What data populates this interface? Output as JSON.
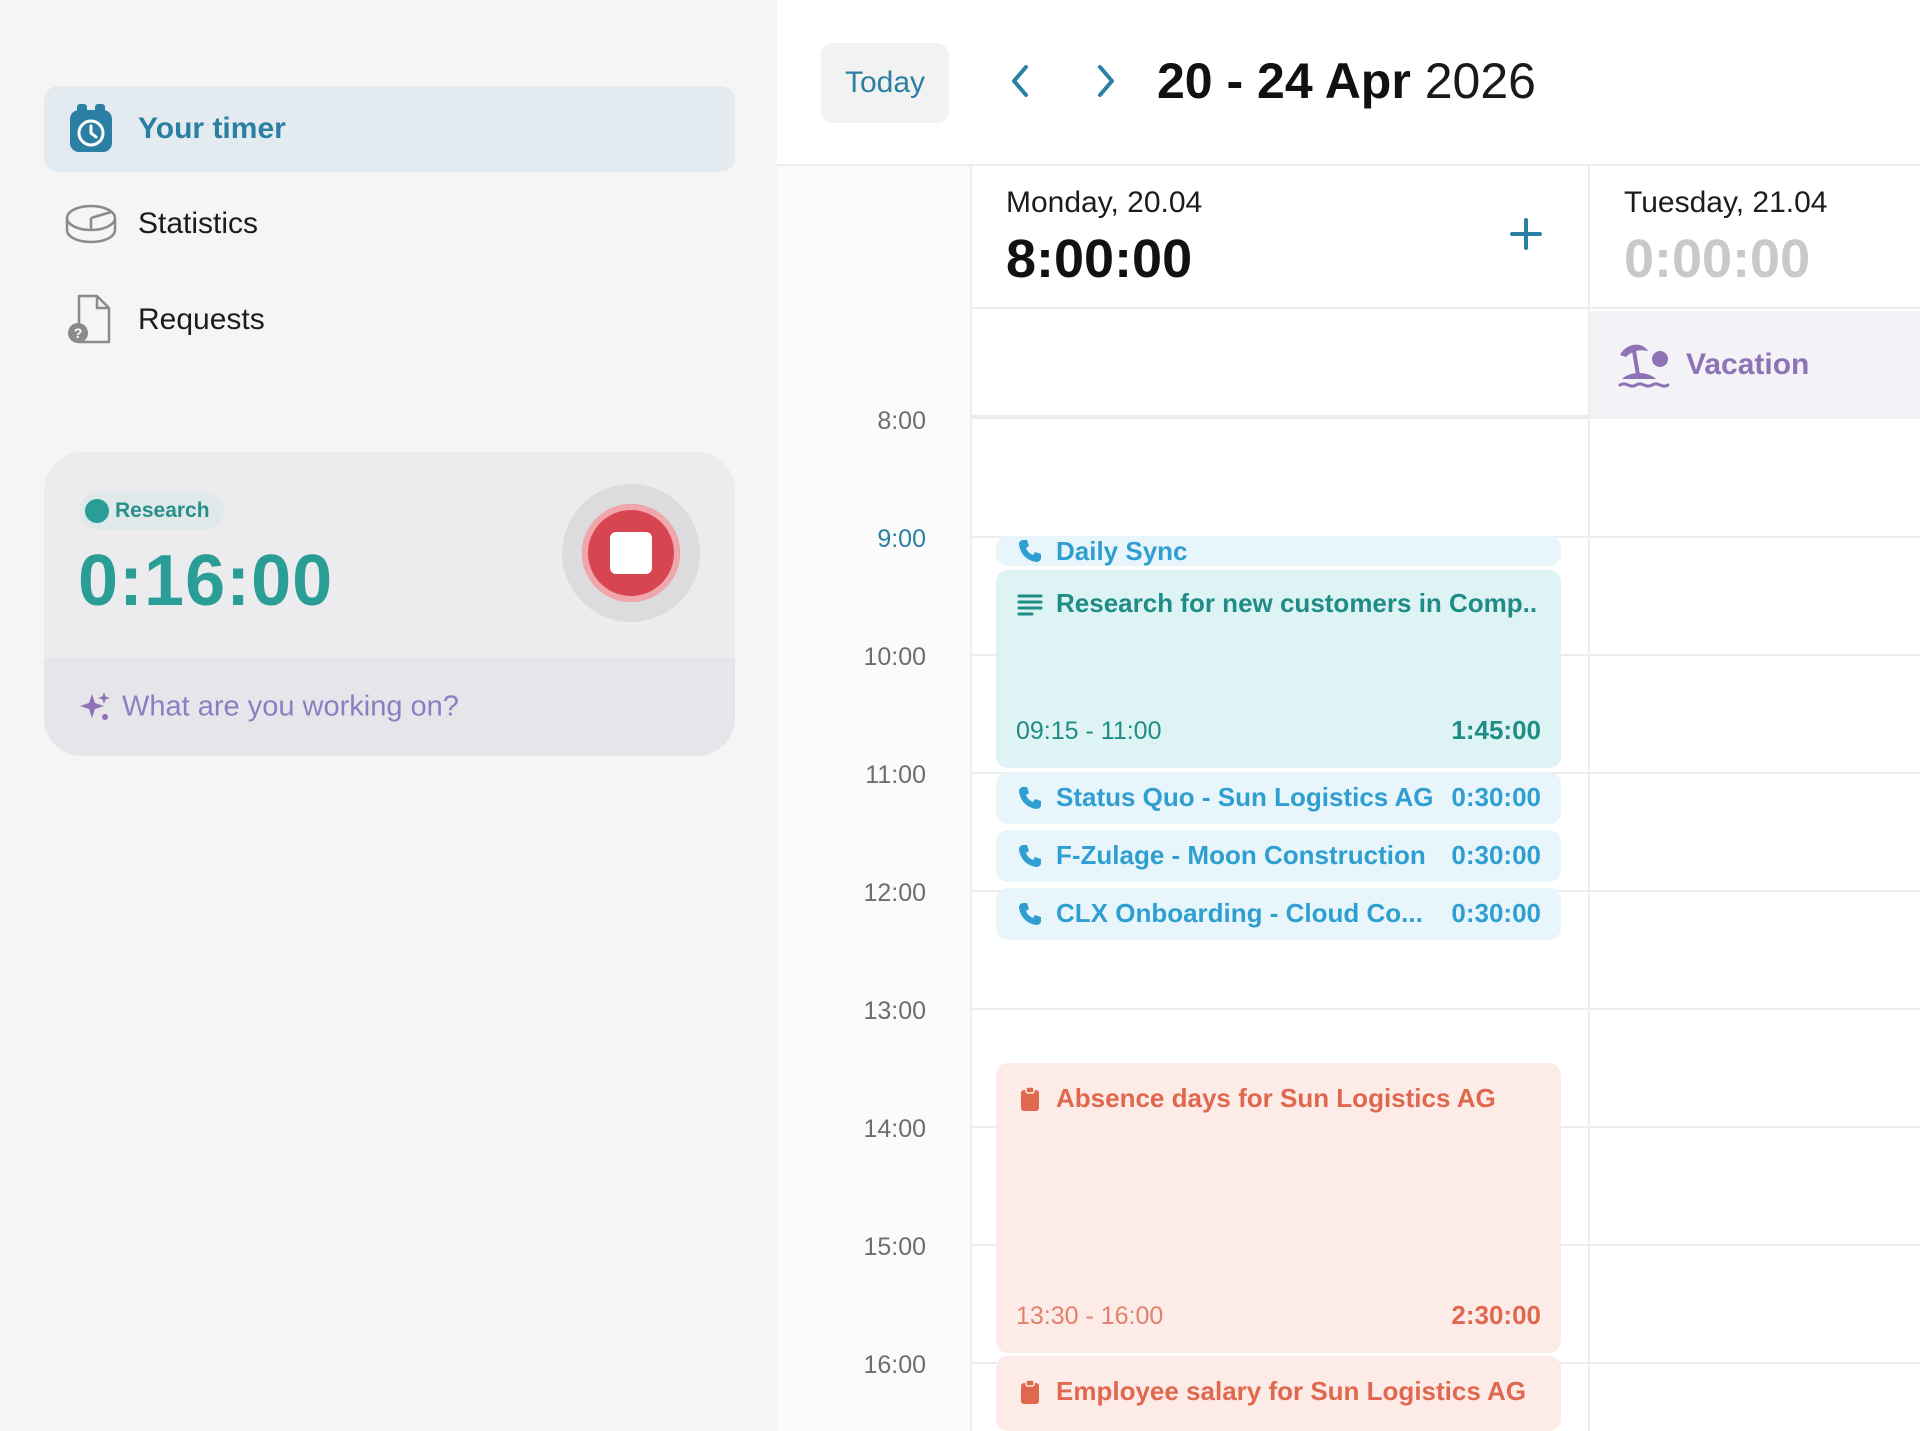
{
  "sidebar": {
    "items": [
      {
        "label": "Your timer",
        "icon": "alarm-clock-icon",
        "active": true
      },
      {
        "label": "Statistics",
        "icon": "pie-chart-icon",
        "active": false
      },
      {
        "label": "Requests",
        "icon": "document-question-icon",
        "active": false
      }
    ],
    "timer": {
      "project": "Research",
      "project_color": "#2a9d97",
      "elapsed": "0:16:00",
      "description_placeholder": "What are you working on?"
    }
  },
  "header": {
    "today_label": "Today",
    "range_bold": "20 - 24 Apr",
    "range_year": "2026"
  },
  "hours": [
    "8:00",
    "9:00",
    "10:00",
    "11:00",
    "12:00",
    "13:00",
    "14:00",
    "15:00",
    "16:00"
  ],
  "current_hour": "9:00",
  "days": [
    {
      "name": "Monday, 20.04",
      "total": "8:00:00"
    },
    {
      "name": "Tuesday, 21.04",
      "total": "0:00:00",
      "all_day": {
        "label": "Vacation",
        "icon": "island-palm-icon"
      }
    }
  ],
  "events": [
    {
      "title": "Daily Sync",
      "icon": "phone-icon",
      "color": "#2f9fd1"
    },
    {
      "title": "Research for new customers in Comp...",
      "icon": "text-lines-icon",
      "time_range": "09:15 - 11:00",
      "duration": "1:45:00",
      "color": "#1f8c86"
    },
    {
      "title": "Status Quo - Sun Logistics AG",
      "icon": "phone-icon",
      "duration": "0:30:00",
      "color": "#2f9fd1"
    },
    {
      "title": "F-Zulage - Moon Construction",
      "icon": "phone-icon",
      "duration": "0:30:00",
      "color": "#2f9fd1"
    },
    {
      "title": "CLX Onboarding - Cloud Co...",
      "icon": "phone-icon",
      "duration": "0:30:00",
      "color": "#2f9fd1"
    },
    {
      "title": "Absence days for Sun Logistics AG",
      "icon": "clipboard-icon",
      "time_range": "13:30 - 16:00",
      "duration": "2:30:00",
      "color": "#e0684f"
    },
    {
      "title": "Employee salary for Sun Logistics AG",
      "icon": "clipboard-icon",
      "color": "#e0684f"
    }
  ],
  "colors": {
    "accent": "#2b7fa3",
    "teal": "#2a9d97",
    "stop_red": "#d64550",
    "vacation_purple": "#8e72b6"
  }
}
